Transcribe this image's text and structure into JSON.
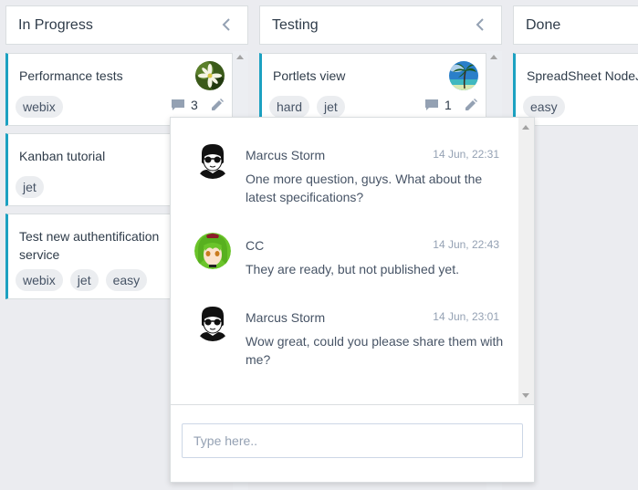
{
  "columns": [
    {
      "title": "In Progress",
      "cards": [
        {
          "title": "Performance tests",
          "tags": [
            "webix"
          ],
          "comments": "3",
          "avatar": "flower"
        },
        {
          "title": "Kanban tutorial",
          "tags": [
            "jet"
          ]
        },
        {
          "title": "Test new authentification service",
          "tags": [
            "webix",
            "jet",
            "easy"
          ]
        }
      ]
    },
    {
      "title": "Testing",
      "cards": [
        {
          "title": "Portlets view",
          "tags": [
            "hard",
            "jet"
          ],
          "comments": "1",
          "avatar": "palm"
        }
      ]
    },
    {
      "title": "Done",
      "cards": [
        {
          "title": "SpreadSheet NodeJS",
          "tags": [
            "easy"
          ]
        }
      ]
    }
  ],
  "chat": {
    "messages": [
      {
        "author": "Marcus Storm",
        "time": "14 Jun, 22:31",
        "text": "One more question, guys. What about the latest specifications?",
        "avatar": "marcus"
      },
      {
        "author": "CC",
        "time": "14 Jun, 22:43",
        "text": "They are ready, but not published yet.",
        "avatar": "cc"
      },
      {
        "author": "Marcus Storm",
        "time": "14 Jun, 23:01",
        "text": "Wow great, could you please share them with me?",
        "avatar": "marcus"
      }
    ],
    "input_placeholder": "Type here..",
    "input_value": ""
  },
  "colors": {
    "accent": "#1ca1c1",
    "background": "#ebecf0",
    "tag_bg": "#ebedf0"
  }
}
